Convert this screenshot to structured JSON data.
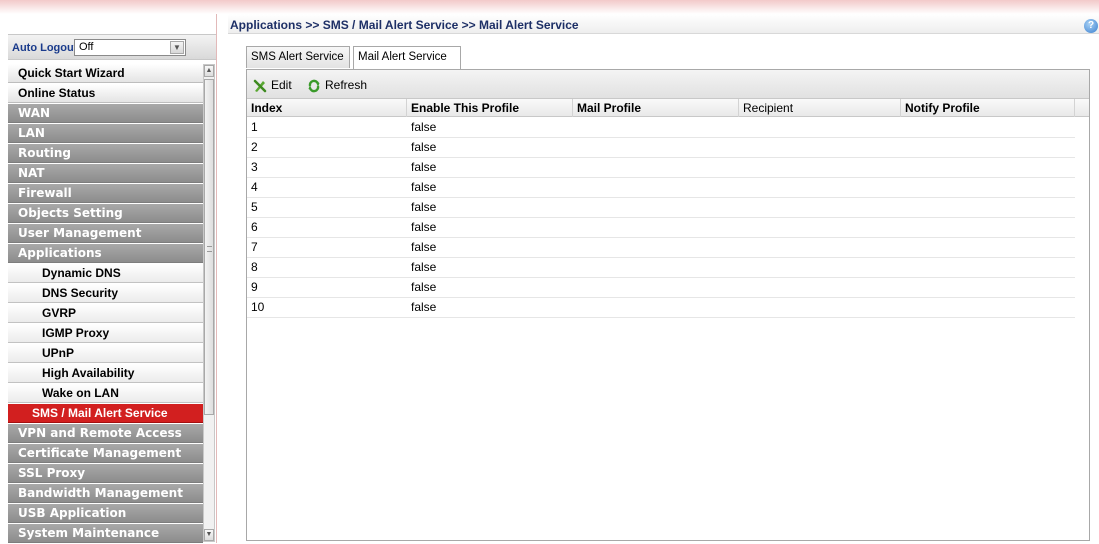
{
  "left_panel": {
    "auto_logout_label": "Auto Logout :",
    "auto_logout_value": "Off",
    "menu": [
      {
        "label": "Quick Start Wizard",
        "style": "light"
      },
      {
        "label": "Online Status",
        "style": "light"
      },
      {
        "label": "WAN",
        "style": "dark"
      },
      {
        "label": "LAN",
        "style": "dark"
      },
      {
        "label": "Routing",
        "style": "dark"
      },
      {
        "label": "NAT",
        "style": "dark"
      },
      {
        "label": "Firewall",
        "style": "dark"
      },
      {
        "label": "Objects Setting",
        "style": "dark"
      },
      {
        "label": "User Management",
        "style": "dark"
      },
      {
        "label": "Applications",
        "style": "dark"
      },
      {
        "label": "Dynamic DNS",
        "style": "sub"
      },
      {
        "label": "DNS Security",
        "style": "sub"
      },
      {
        "label": "GVRP",
        "style": "sub"
      },
      {
        "label": "IGMP Proxy",
        "style": "sub"
      },
      {
        "label": "UPnP",
        "style": "sub"
      },
      {
        "label": "High Availability",
        "style": "sub"
      },
      {
        "label": "Wake on LAN",
        "style": "sub"
      },
      {
        "label": "SMS / Mail Alert Service",
        "style": "active"
      },
      {
        "label": "VPN and Remote Access",
        "style": "dark"
      },
      {
        "label": "Certificate Management",
        "style": "dark"
      },
      {
        "label": "SSL Proxy",
        "style": "dark"
      },
      {
        "label": "Bandwidth Management",
        "style": "dark"
      },
      {
        "label": "USB Application",
        "style": "dark"
      },
      {
        "label": "System Maintenance",
        "style": "dark"
      }
    ]
  },
  "breadcrumb": "Applications >> SMS / Mail Alert Service >> Mail Alert Service",
  "help_icon": "?",
  "tabs": [
    {
      "label": "SMS Alert Service"
    },
    {
      "label": "Mail Alert Service"
    }
  ],
  "toolbar": {
    "edit_label": "Edit",
    "refresh_label": "Refresh"
  },
  "table": {
    "columns": [
      "Index",
      "Enable This Profile",
      "Mail Profile",
      "Recipient",
      "Notify Profile"
    ],
    "rows": [
      {
        "index": "1",
        "enable": "false"
      },
      {
        "index": "2",
        "enable": "false"
      },
      {
        "index": "3",
        "enable": "false"
      },
      {
        "index": "4",
        "enable": "false"
      },
      {
        "index": "5",
        "enable": "false"
      },
      {
        "index": "6",
        "enable": "false"
      },
      {
        "index": "7",
        "enable": "false"
      },
      {
        "index": "8",
        "enable": "false"
      },
      {
        "index": "9",
        "enable": "false"
      },
      {
        "index": "10",
        "enable": "false"
      }
    ]
  },
  "colors": {
    "active_menu": "#d21f1f",
    "dark_menu": "#9a9a9a",
    "breadcrumb_text": "#1d2f66"
  }
}
